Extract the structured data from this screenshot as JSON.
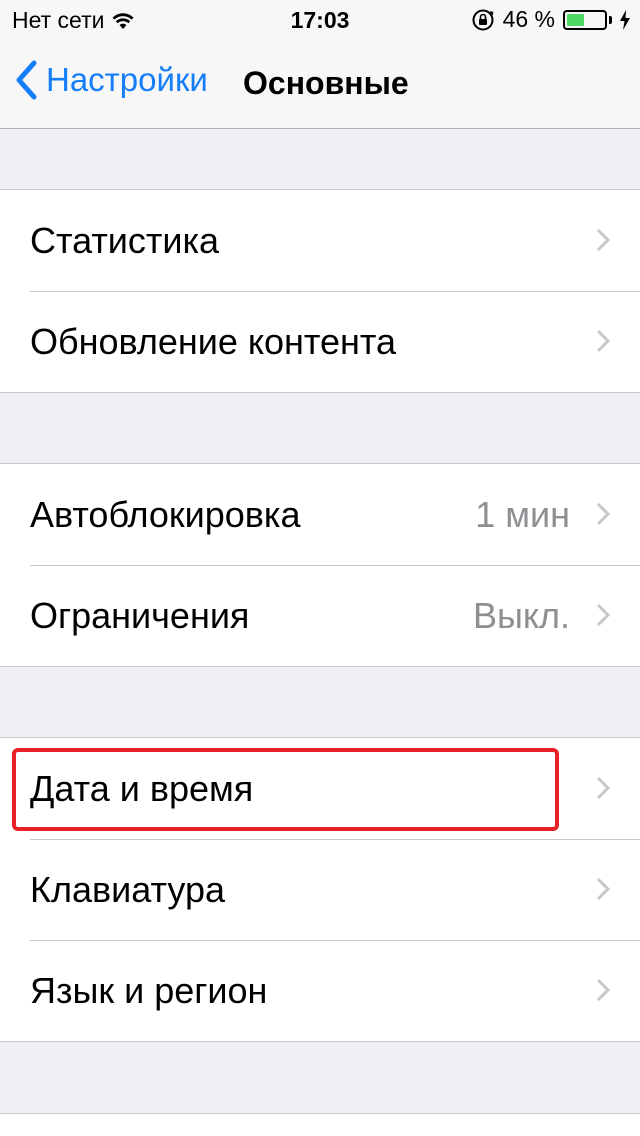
{
  "status_bar": {
    "carrier": "Нет сети",
    "time": "17:03",
    "battery_percent_text": "46 %",
    "battery_level": 0.46,
    "battery_color": "#4cd964"
  },
  "nav": {
    "back_label": "Настройки",
    "title": "Основные",
    "accent_color": "#157efb"
  },
  "groups": [
    {
      "rows": [
        {
          "label": "Статистика",
          "value": ""
        },
        {
          "label": "Обновление контента",
          "value": ""
        }
      ]
    },
    {
      "rows": [
        {
          "label": "Автоблокировка",
          "value": "1 мин"
        },
        {
          "label": "Ограничения",
          "value": "Выкл."
        }
      ]
    },
    {
      "rows": [
        {
          "label": "Дата и время",
          "value": "",
          "highlighted": true
        },
        {
          "label": "Клавиатура",
          "value": ""
        },
        {
          "label": "Язык и регион",
          "value": ""
        }
      ]
    }
  ],
  "icons": {
    "wifi": "wifi-icon",
    "rotation_lock": "rotation-lock-icon",
    "battery": "battery-icon",
    "charging": "charging-bolt-icon",
    "back": "chevron-left-icon",
    "disclosure": "chevron-right-icon"
  },
  "highlight_color": "#e8202a"
}
